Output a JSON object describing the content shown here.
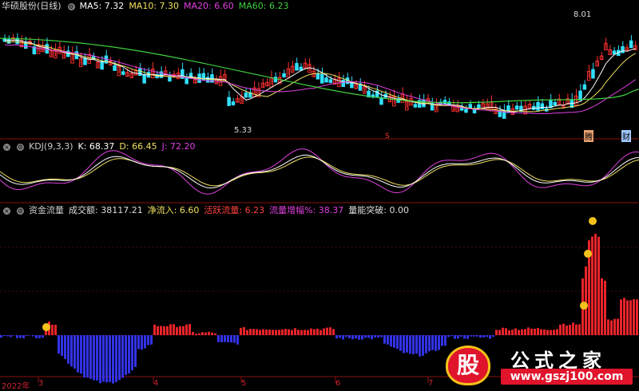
{
  "price_panel": {
    "stock_name": "华硕股份(日线)",
    "indicators": [
      {
        "label": "MA5: 7.32",
        "color": "#ffffff"
      },
      {
        "label": "MA10: 7.30",
        "color": "#f0e060"
      },
      {
        "label": "MA20: 6.60",
        "color": "#e040e0"
      },
      {
        "label": "MA60: 6.23",
        "color": "#40d040"
      }
    ],
    "high_label": "8.01",
    "low_label": "5.33",
    "markers": {
      "mid": "S",
      "right1": "腾",
      "right2": "财"
    }
  },
  "kdj_panel": {
    "title": "KDJ(9,3,3)",
    "k": "K: 68.37",
    "d": "D: 66.45",
    "j": "J: 72.20",
    "colors": {
      "k": "#ffffff",
      "d": "#f0e060",
      "j": "#e040e0"
    }
  },
  "flow_panel": {
    "title": "资金流量",
    "volume": "成交额: 38117.21",
    "net_inflow": "净流入: 6.60",
    "active_flow": "活跃流量: 6.23",
    "flow_ratio": "流量增幅%: 38.37",
    "breakthrough": "量能突破: 0.00",
    "colors": {
      "up": "#e8242a",
      "down": "#3232e6",
      "net_inflow": "#f0e060",
      "active": "#ff4040",
      "ratio": "#e040e0"
    }
  },
  "x_axis": {
    "labels": [
      "2022年",
      "3",
      "4",
      "5",
      "6",
      "7"
    ]
  },
  "watermark": {
    "badge": "股",
    "title": "公式之家",
    "url": "www.gszj100.com"
  }
}
